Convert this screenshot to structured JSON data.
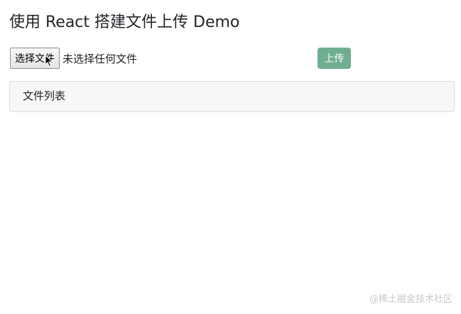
{
  "page": {
    "title": "使用 React 搭建文件上传 Demo"
  },
  "file_input": {
    "button_label": "选择文件",
    "status_text": "未选择任何文件"
  },
  "upload": {
    "label": "上传"
  },
  "file_list": {
    "header": "文件列表"
  },
  "watermark": {
    "text": "@稀土掘金技术社区"
  },
  "colors": {
    "upload_button": "#6fae91",
    "card_background": "#f7f7f7"
  },
  "icons": {
    "cursor": "mouse-pointer-icon"
  }
}
